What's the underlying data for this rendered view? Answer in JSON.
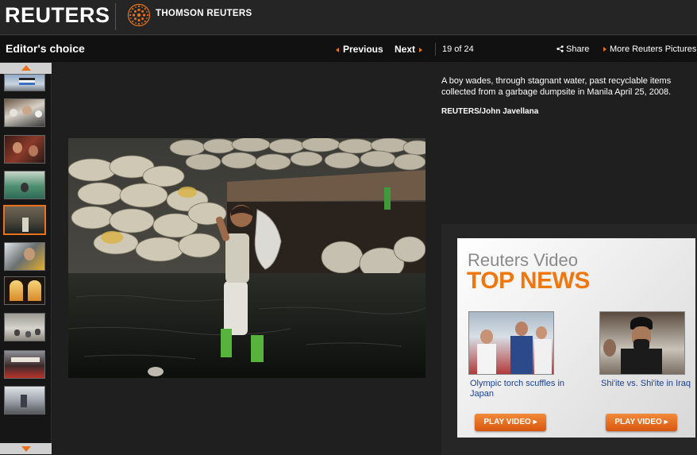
{
  "header": {
    "logo_text": "REUTERS",
    "partner_text": "THOMSON REUTERS"
  },
  "nav": {
    "section_title": "Editor's choice",
    "previous_label": "Previous",
    "next_label": "Next",
    "counter": "19 of 24",
    "share_label": "Share",
    "more_label": "More Reuters Pictures"
  },
  "sidebar": {
    "thumbnails": [
      {
        "name": "thumb-flag"
      },
      {
        "name": "thumb-crowd"
      },
      {
        "name": "thumb-people"
      },
      {
        "name": "thumb-stadium"
      },
      {
        "name": "thumb-garbage",
        "active": true
      },
      {
        "name": "thumb-protest"
      },
      {
        "name": "thumb-church"
      },
      {
        "name": "thumb-ducks"
      },
      {
        "name": "thumb-market"
      },
      {
        "name": "thumb-street"
      }
    ]
  },
  "photo": {
    "caption": "A boy wades, through stagnant water, past recyclable items collected from a garbage dumpsite in Manila April 25, 2008.",
    "credit": "REUTERS/John Javellana"
  },
  "ad": {
    "brand": "Reuters Video",
    "headline": "TOP NEWS",
    "videos": [
      {
        "title": "Olympic torch scuffles in Japan",
        "button": "PLAY VIDEO"
      },
      {
        "title": "Shi'ite vs. Shi'ite in Iraq",
        "button": "PLAY VIDEO"
      }
    ]
  },
  "colors": {
    "accent": "#e8721c",
    "background": "#1f1f1f",
    "link_blue": "#1a3f8f"
  }
}
